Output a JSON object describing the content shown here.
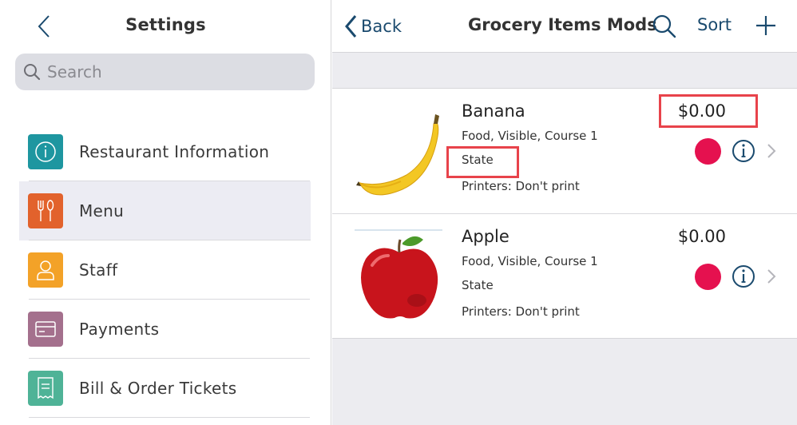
{
  "settings": {
    "title": "Settings",
    "search_placeholder": "Search",
    "items": [
      {
        "label": "Restaurant Information",
        "icon": "info-icon",
        "color": "#1e96a0"
      },
      {
        "label": "Menu",
        "icon": "fork-knife-icon",
        "color": "#e2622c"
      },
      {
        "label": "Staff",
        "icon": "person-icon",
        "color": "#f3a228"
      },
      {
        "label": "Payments",
        "icon": "card-icon",
        "color": "#a4708d"
      },
      {
        "label": "Bill & Order Tickets",
        "icon": "receipt-icon",
        "color": "#4fb397"
      }
    ]
  },
  "detail": {
    "back_label": "Back",
    "title": "Grocery Items Mods",
    "sort_label": "Sort",
    "items": [
      {
        "name": "Banana",
        "details": "Food, Visible, Course 1",
        "state": "State",
        "printers": "Printers: Don't print",
        "price": "$0.00",
        "color": "#e5114f"
      },
      {
        "name": "Apple",
        "details": "Food, Visible, Course 1",
        "state": "State",
        "printers": "Printers: Don't print",
        "price": "$0.00",
        "color": "#e5114f"
      }
    ]
  },
  "colors": {
    "accent": "#1a4a6e",
    "highlight": "#e8434b",
    "selected_row": "#ececf3"
  }
}
